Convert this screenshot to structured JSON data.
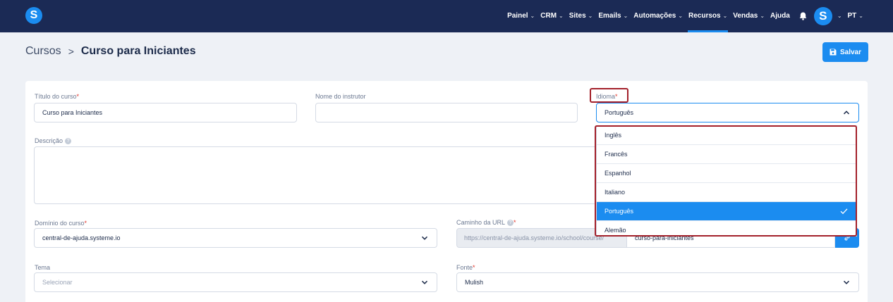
{
  "app": {
    "logo_letter": "S",
    "accent_color": "#1b8cf0",
    "nav_bg": "#1b2a55",
    "alert_color": "#a3202a"
  },
  "nav": {
    "items": [
      {
        "label": "Painel",
        "chevron": true,
        "active": false
      },
      {
        "label": "CRM",
        "chevron": true,
        "active": false
      },
      {
        "label": "Sites",
        "chevron": true,
        "active": false
      },
      {
        "label": "Emails",
        "chevron": true,
        "active": false
      },
      {
        "label": "Automações",
        "chevron": true,
        "active": false
      },
      {
        "label": "Recursos",
        "chevron": true,
        "active": true
      },
      {
        "label": "Vendas",
        "chevron": true,
        "active": false
      },
      {
        "label": "Ajuda",
        "chevron": false,
        "active": false
      }
    ],
    "bell_icon": "bell-icon",
    "avatar_letter": "S",
    "language": "PT"
  },
  "header": {
    "breadcrumb_root": "Cursos",
    "breadcrumb_sep": ">",
    "breadcrumb_current": "Curso para Iniciantes",
    "save_label": "Salvar",
    "save_icon": "floppy-disk-icon"
  },
  "form": {
    "title_label": "Título do curso",
    "title_value": "Curso para Iniciantes",
    "instructor_label": "Nome do instrutor",
    "instructor_value": "",
    "language_label": "Idioma",
    "language_value": "Português",
    "description_label": "Descrição",
    "description_value": "",
    "domain_label": "Domínio do curso",
    "domain_value": "central-de-ajuda.systeme.io",
    "url_label": "Caminho da URL",
    "url_prefix": "https://central-de-ajuda.systeme.io/school/course/",
    "url_slug": "curso-para-iniciantes",
    "theme_label": "Tema",
    "theme_placeholder": "Selecionar",
    "font_label": "Fonte",
    "font_value": "Mulish",
    "required_mark": "*",
    "help_mark": "?"
  },
  "language_dropdown": {
    "options": [
      "Inglês",
      "Francês",
      "Espanhol",
      "Italiano",
      "Português",
      "Alemão"
    ],
    "selected": "Português"
  }
}
